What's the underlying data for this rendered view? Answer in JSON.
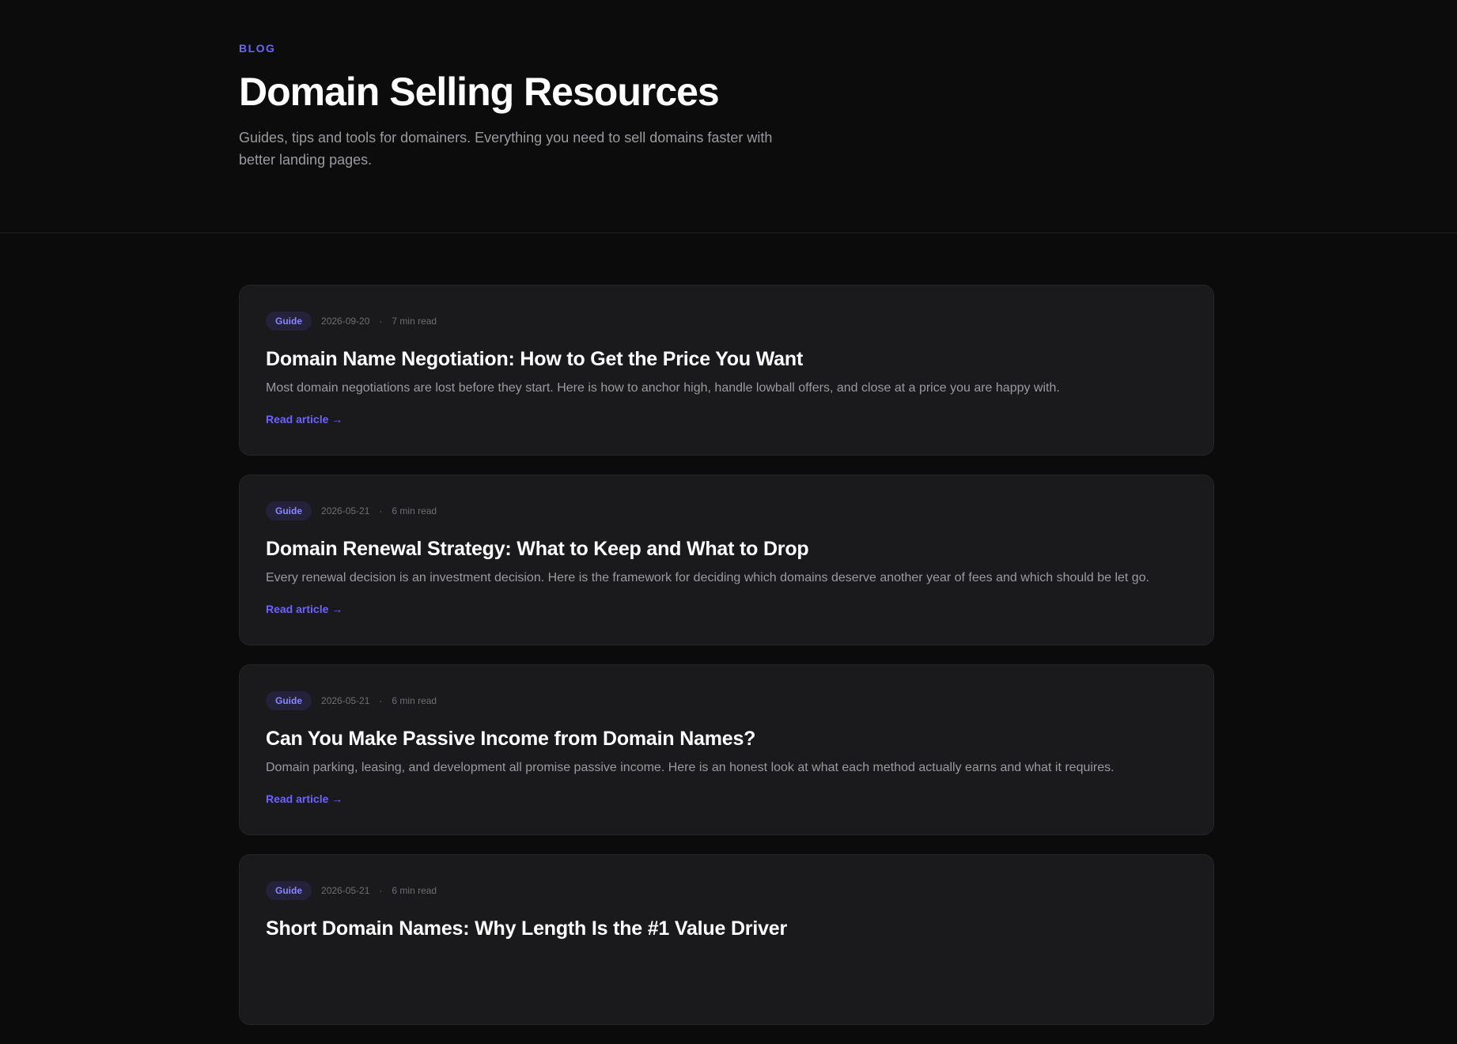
{
  "hero": {
    "eyebrow": "BLOG",
    "title": "Domain Selling Resources",
    "subtitle": "Guides, tips and tools for domainers. Everything you need to sell domains faster with better landing pages."
  },
  "meta_separator": "·",
  "articles": [
    {
      "tag": "Guide",
      "date": "2026-09-20",
      "read_time": "7 min read",
      "title": "Domain Name Negotiation: How to Get the Price You Want",
      "excerpt": "Most domain negotiations are lost before they start. Here is how to anchor high, handle lowball offers, and close at a price you are happy with.",
      "link_label": "Read article →"
    },
    {
      "tag": "Guide",
      "date": "2026-05-21",
      "read_time": "6 min read",
      "title": "Domain Renewal Strategy: What to Keep and What to Drop",
      "excerpt": "Every renewal decision is an investment decision. Here is the framework for deciding which domains deserve another year of fees and which should be let go.",
      "link_label": "Read article →"
    },
    {
      "tag": "Guide",
      "date": "2026-05-21",
      "read_time": "6 min read",
      "title": "Can You Make Passive Income from Domain Names?",
      "excerpt": "Domain parking, leasing, and development all promise passive income. Here is an honest look at what each method actually earns and what it requires.",
      "link_label": "Read article →"
    },
    {
      "tag": "Guide",
      "date": "2026-05-21",
      "read_time": "6 min read",
      "title": "Short Domain Names: Why Length Is the #1 Value Driver",
      "excerpt": "",
      "link_label": ""
    }
  ],
  "colors": {
    "background": "#0b0b0c",
    "card": "#1a1a1c",
    "accent": "#6c63ff",
    "text_muted": "#9a9aa0"
  }
}
